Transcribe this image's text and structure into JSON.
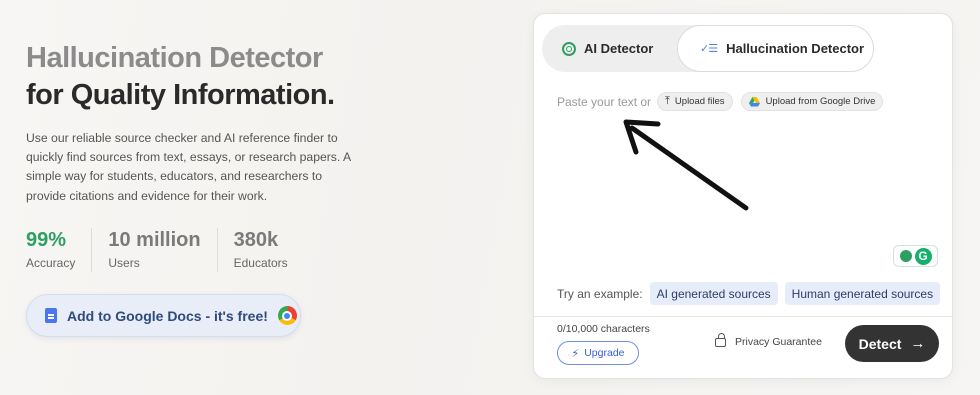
{
  "hero": {
    "title_line1": "Hallucination Detector",
    "title_line2": "for Quality Information.",
    "description": "Use our reliable source checker and AI reference finder to quickly find sources from text, essays, or research papers. A simple way for students, educators, and researchers to provide citations and evidence for their work.",
    "stats": [
      {
        "value": "99%",
        "label": "Accuracy"
      },
      {
        "value": "10 million",
        "label": "Users"
      },
      {
        "value": "380k",
        "label": "Educators"
      }
    ],
    "cta_label": "Add to Google Docs - it's free!"
  },
  "detector": {
    "tabs": [
      {
        "label": "AI Detector",
        "icon": "ai-detector-icon",
        "active": false
      },
      {
        "label": "Hallucination Detector",
        "icon": "checklist-icon",
        "active": true
      }
    ],
    "placeholder": "Paste your text or",
    "upload_files_label": "Upload files",
    "upload_drive_label": "Upload from Google Drive",
    "try_label": "Try an example:",
    "examples": [
      "AI generated sources",
      "Human generated sources"
    ],
    "char_count": "0/10,000 characters",
    "upgrade_label": "Upgrade",
    "privacy_label": "Privacy Guarantee",
    "detect_label": "Detect"
  },
  "colors": {
    "accent_green": "#2e9f62",
    "accent_blue": "#3a5fcf",
    "detect_bg": "#333333"
  }
}
